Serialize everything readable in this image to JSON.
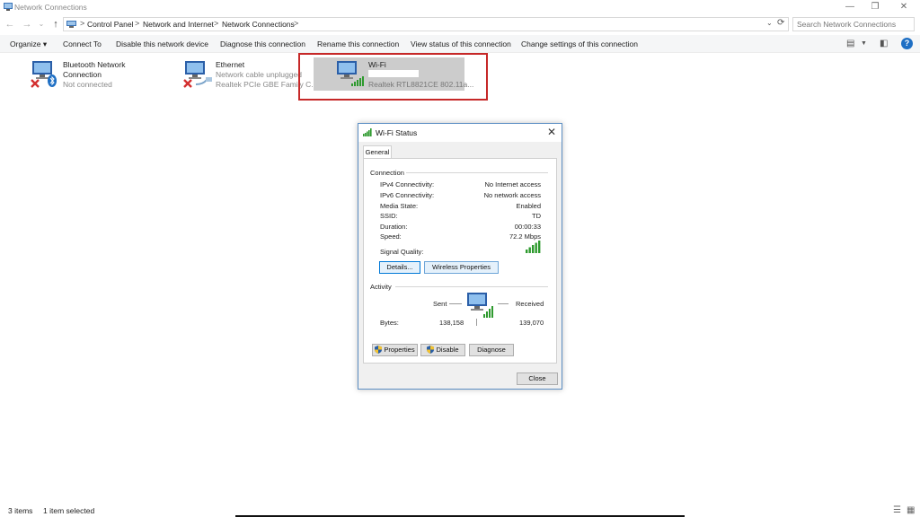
{
  "window": {
    "title": "Network Connections",
    "controls": {
      "minimize": "—",
      "maximize": "❐",
      "close": "✕"
    }
  },
  "navigation": {
    "back": "←",
    "forward": "→",
    "recent": "⌄",
    "up": "↑",
    "breadcrumbs": [
      "Control Panel",
      "Network and Internet",
      "Network Connections"
    ],
    "separator": ">",
    "search_placeholder": "Search Network Connections"
  },
  "commands": {
    "organize": "Organize ▾",
    "items": [
      "Connect To",
      "Disable this network device",
      "Diagnose this connection",
      "Rename this connection",
      "View status of this connection",
      "Change settings of this connection"
    ],
    "help": "?"
  },
  "adapters": [
    {
      "name_line1": "Bluetooth Network",
      "name_line2": "Connection",
      "status": "Not connected",
      "device": ""
    },
    {
      "name_line1": "Ethernet",
      "name_line2": "",
      "status": "Network cable unplugged",
      "device": "Realtek PCIe GBE Family C..."
    },
    {
      "name_line1": "Wi-Fi",
      "name_line2": "",
      "status": "",
      "device": "Realtek RTL8821CE 802.11a..."
    }
  ],
  "dialog": {
    "title": "Wi-Fi Status",
    "close": "✕",
    "tab": "General",
    "connection_label": "Connection",
    "rows": [
      {
        "label": "IPv4 Connectivity:",
        "value": "No Internet access"
      },
      {
        "label": "IPv6 Connectivity:",
        "value": "No network access"
      },
      {
        "label": "Media State:",
        "value": "Enabled"
      },
      {
        "label": "SSID:",
        "value": "TD"
      },
      {
        "label": "Duration:",
        "value": "00:00:33"
      },
      {
        "label": "Speed:",
        "value": "72.2 Mbps"
      }
    ],
    "signal_quality_label": "Signal Quality:",
    "signal_bars": 5,
    "details_button": "Details...",
    "wireless_properties_button": "Wireless Properties",
    "activity_label": "Activity",
    "sent_label": "Sent",
    "received_label": "Received",
    "bytes_label": "Bytes:",
    "bytes_sent": "138,158",
    "bytes_received": "139,070",
    "properties_button": "Properties",
    "disable_button": "Disable",
    "diagnose_button": "Diagnose",
    "close_button": "Close"
  },
  "status_bar": {
    "items_count": "3 items",
    "selected_count": "1 item selected"
  },
  "colors": {
    "selection": "#cccccc",
    "highlight_box": "#c62828",
    "signal_green": "#2e9a2e",
    "accent_blue": "#0078d7"
  },
  "icons": {
    "app": "network-connections-icon",
    "adapter": "network-adapter-icon",
    "disconnected": "red-x-icon",
    "bluetooth": "bluetooth-icon",
    "cable": "ethernet-cable-icon",
    "signal": "signal-bars-icon",
    "shield": "uac-shield-icon"
  }
}
